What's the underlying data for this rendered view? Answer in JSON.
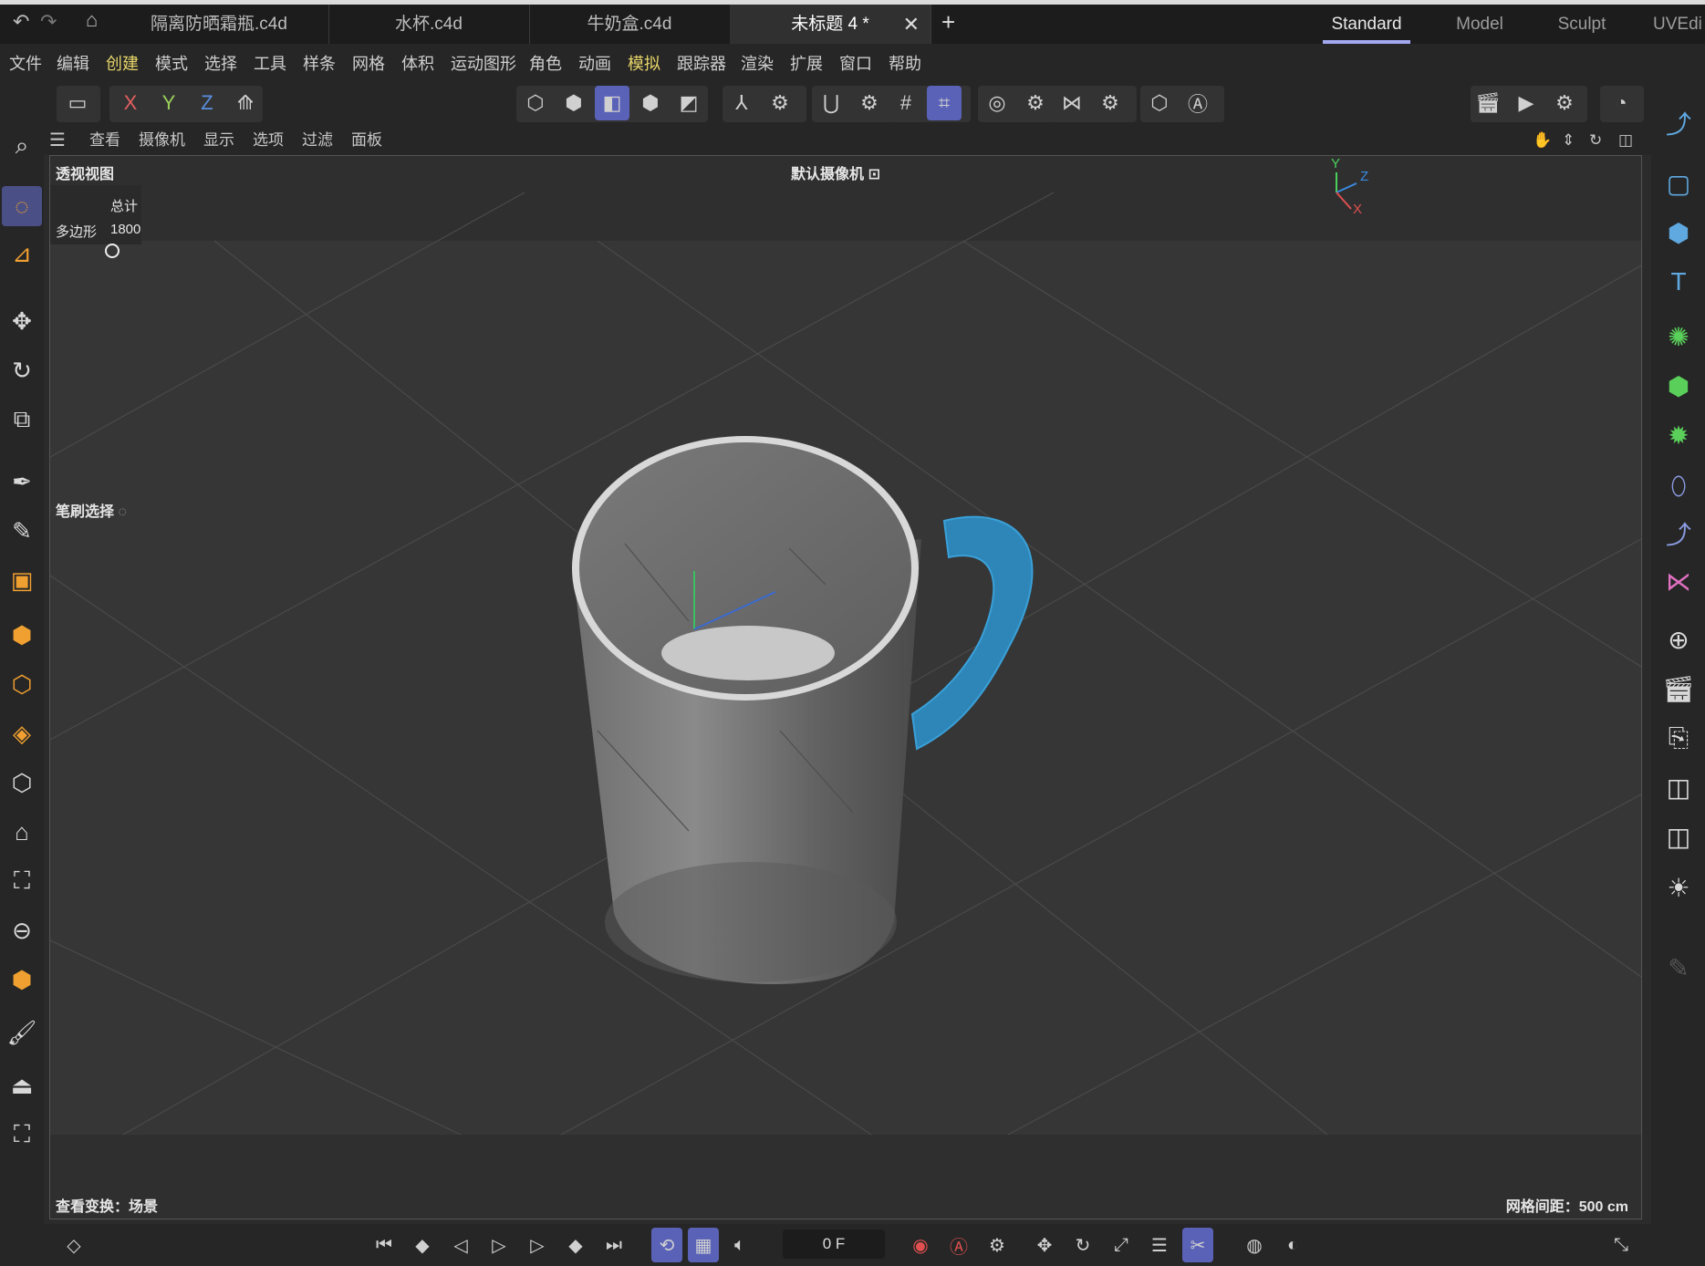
{
  "tabs": [
    {
      "label": "隔离防晒霜瓶.c4d"
    },
    {
      "label": "水杯.c4d"
    },
    {
      "label": "牛奶盒.c4d"
    },
    {
      "label": "未标题 4 *"
    }
  ],
  "tab_close": "✕",
  "tab_add": "+",
  "layouts": [
    "Standard",
    "Model",
    "Sculpt",
    "UVEdi"
  ],
  "menus": [
    "文件",
    "编辑",
    "创建",
    "模式",
    "选择",
    "工具",
    "样条",
    "网格",
    "体积",
    "运动图形",
    "角色",
    "动画",
    "模拟",
    "跟踪器",
    "渲染",
    "扩展",
    "窗口",
    "帮助"
  ],
  "axis_buttons": {
    "x": "X",
    "y": "Y",
    "z": "Z"
  },
  "viewport_menu": [
    "查看",
    "摄像机",
    "显示",
    "选项",
    "过滤",
    "面板"
  ],
  "viewport": {
    "name": "透视视图",
    "camera": "默认摄像机",
    "camera_icon": "⊡",
    "stats_header": "总计",
    "stats_label": "多边形",
    "stats_value": "1800",
    "brush_label": "笔刷选择",
    "transform_info": "查看变换：场景",
    "grid_spacing": "网格间距：500 cm",
    "axis_labels": {
      "y": "Y",
      "z": "Z",
      "x": "X"
    }
  },
  "timeline": {
    "frame": "0 F"
  },
  "colors": {
    "accent": "#5a62b8",
    "handle": "#2e86b8",
    "menu_highlight": "#e8d66a"
  }
}
